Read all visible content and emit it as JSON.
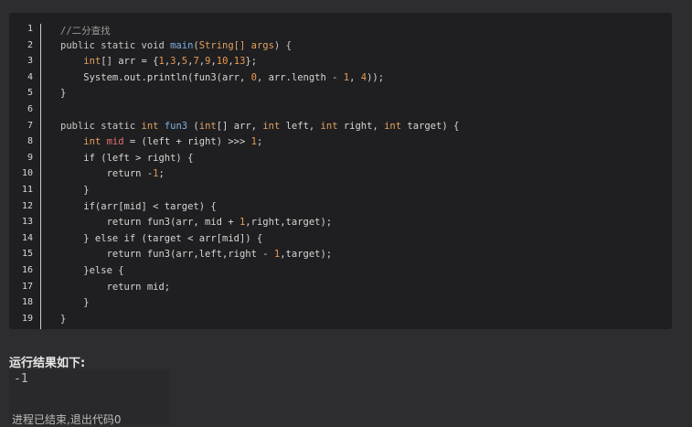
{
  "code": {
    "lines": [
      [
        [
          "//二分查找",
          "c"
        ]
      ],
      [
        [
          "public static void ",
          "k"
        ],
        [
          "main",
          "f"
        ],
        [
          "(",
          "k"
        ],
        [
          "String[] args",
          "p"
        ],
        [
          ") {",
          "k"
        ]
      ],
      [
        [
          "    "
        ],
        [
          "int",
          "t"
        ],
        [
          "[] arr = {"
        ],
        [
          "1",
          "n"
        ],
        [
          ","
        ],
        [
          "3",
          "n"
        ],
        [
          ","
        ],
        [
          "5",
          "n"
        ],
        [
          ","
        ],
        [
          "7",
          "n"
        ],
        [
          ","
        ],
        [
          "9",
          "n"
        ],
        [
          ","
        ],
        [
          "10",
          "n"
        ],
        [
          ","
        ],
        [
          "13",
          "n"
        ],
        [
          "};"
        ]
      ],
      [
        [
          "    System.out.println(fun3(arr, "
        ],
        [
          "0",
          "n"
        ],
        [
          ", arr.length - "
        ],
        [
          "1",
          "n"
        ],
        [
          ", "
        ],
        [
          "4",
          "n"
        ],
        [
          "));"
        ]
      ],
      [
        [
          "}"
        ]
      ],
      [
        [
          ""
        ]
      ],
      [
        [
          "public static ",
          "k"
        ],
        [
          "int",
          "t"
        ],
        [
          " "
        ],
        [
          "fun3",
          "f"
        ],
        [
          " ("
        ],
        [
          "int",
          "t"
        ],
        [
          "[] arr, "
        ],
        [
          "int",
          "t"
        ],
        [
          " left, "
        ],
        [
          "int",
          "t"
        ],
        [
          " right, "
        ],
        [
          "int",
          "t"
        ],
        [
          " target) {"
        ]
      ],
      [
        [
          "    "
        ],
        [
          "int",
          "t"
        ],
        [
          " "
        ],
        [
          "mid",
          "v"
        ],
        [
          " = (left + right) >>> "
        ],
        [
          "1",
          "n"
        ],
        [
          ";"
        ]
      ],
      [
        [
          "    if (left > right) {"
        ]
      ],
      [
        [
          "        return -"
        ],
        [
          "1",
          "n"
        ],
        [
          ";"
        ]
      ],
      [
        [
          "    }"
        ]
      ],
      [
        [
          "    if(arr[mid] < target) {"
        ]
      ],
      [
        [
          "        return fun3(arr, mid + "
        ],
        [
          "1",
          "n"
        ],
        [
          ",right,target);"
        ]
      ],
      [
        [
          "    } else if (target < arr[mid]) {"
        ]
      ],
      [
        [
          "        return fun3(arr,left,right - "
        ],
        [
          "1",
          "n"
        ],
        [
          ",target);"
        ]
      ],
      [
        [
          "    }else {"
        ]
      ],
      [
        [
          "        return mid;"
        ]
      ],
      [
        [
          "    }"
        ]
      ],
      [
        [
          "}"
        ]
      ]
    ]
  },
  "result": {
    "title": "运行结果如下:",
    "output": "-1",
    "exit": "进程已结束,退出代码0"
  }
}
